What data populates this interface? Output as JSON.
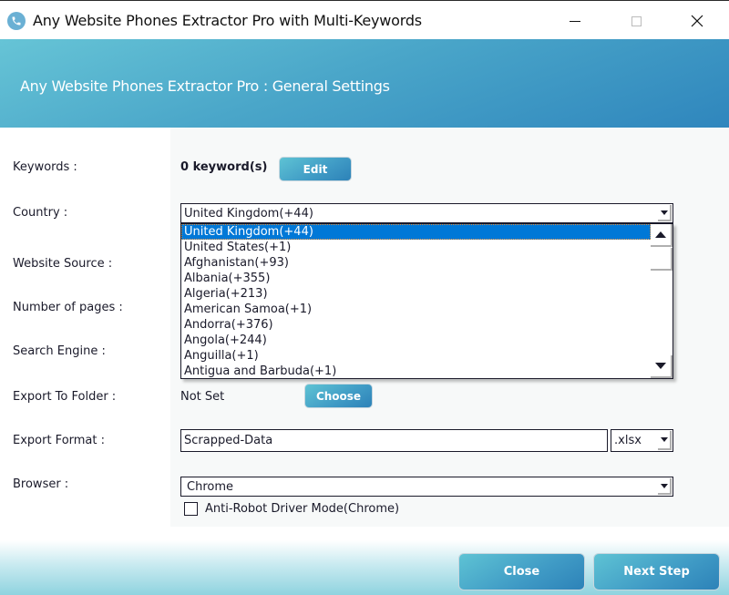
{
  "window": {
    "title": "Any Website Phones Extractor Pro with Multi-Keywords",
    "app_icon": "phone-icon",
    "controls": {
      "minimize": "minimize-icon",
      "maximize": "maximize-icon",
      "close": "close-icon"
    }
  },
  "header": {
    "title": "Any Website Phones Extractor Pro : General Settings"
  },
  "form": {
    "labels": {
      "keywords": "Keywords :",
      "country": "Country :",
      "website_source": "Website Source :",
      "number_of_pages": "Number of pages :",
      "search_engine": "Search Engine :",
      "export_to_folder": "Export To Folder :",
      "export_format": "Export Format :",
      "browser": "Browser :"
    },
    "keywords": {
      "count_text": "0 keyword(s)",
      "edit_label": "Edit"
    },
    "country": {
      "selected": "United Kingdom(+44)",
      "options": [
        "United Kingdom(+44)",
        "United States(+1)",
        "Afghanistan(+93)",
        "Albania(+355)",
        "Algeria(+213)",
        "American Samoa(+1)",
        "Andorra(+376)",
        "Angola(+244)",
        "Anguilla(+1)",
        "Antigua and Barbuda(+1)"
      ],
      "highlighted_index": 0
    },
    "export_folder": {
      "value": "Not Set",
      "choose_label": "Choose"
    },
    "export_format": {
      "filename": "Scrapped-Data",
      "extension": ".xlsx"
    },
    "browser": {
      "selected": "Chrome",
      "anti_robot_label": "Anti-Robot Driver Mode(Chrome)",
      "anti_robot_checked": false
    }
  },
  "footer": {
    "close_label": "Close",
    "next_label": "Next Step"
  },
  "colors": {
    "accent": "#3f9ac5",
    "selection": "#0078d7",
    "header_gradient_start": "#66c4d6",
    "header_gradient_end": "#2f86bd"
  }
}
